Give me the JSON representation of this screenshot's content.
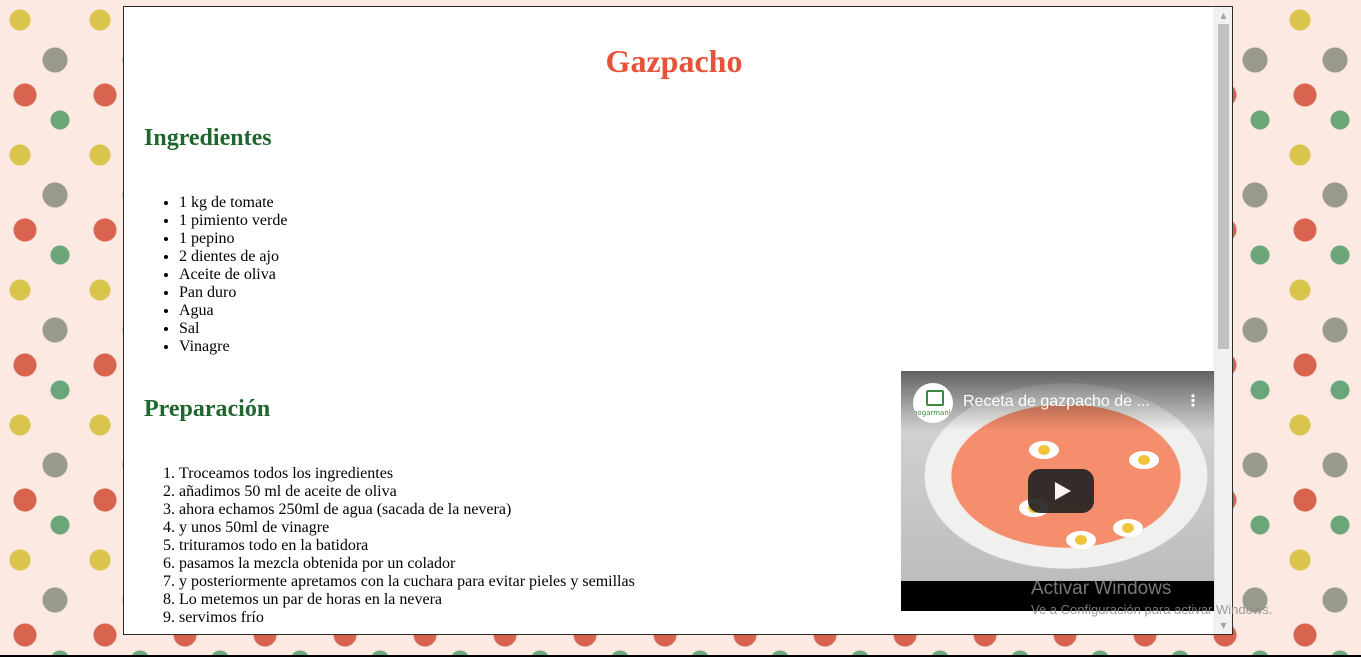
{
  "page": {
    "title": "Gazpacho"
  },
  "ingredients": {
    "heading": "Ingredientes",
    "items": [
      "1 kg de tomate",
      "1 pimiento verde",
      "1 pepino",
      "2 dientes de ajo",
      "Aceite de oliva",
      "Pan duro",
      "Agua",
      "Sal",
      "Vinagre"
    ]
  },
  "preparation": {
    "heading": "Preparación",
    "steps": [
      "Troceamos todos los ingredientes",
      "añadimos 50 ml de aceite de oliva",
      "ahora echamos 250ml de agua (sacada de la nevera)",
      "y unos 50ml de vinagre",
      "trituramos todo en la batidora",
      "pasamos la mezcla obtenida por un colador",
      "y posteriormente apretamos con la cuchara para evitar pieles y semillas",
      "Lo metemos un par de horas en la nevera",
      "servimos frío"
    ]
  },
  "video": {
    "title": "Receta de gazpacho de ...",
    "channel": "hogarmania",
    "menu_icon": "more-vertical-icon",
    "play_icon": "play-icon"
  },
  "watermark": {
    "title": "Activar Windows",
    "subtitle": "Ve a Configuración para activar Windows."
  },
  "colors": {
    "title": "#e5533b",
    "heading": "#20662f"
  }
}
